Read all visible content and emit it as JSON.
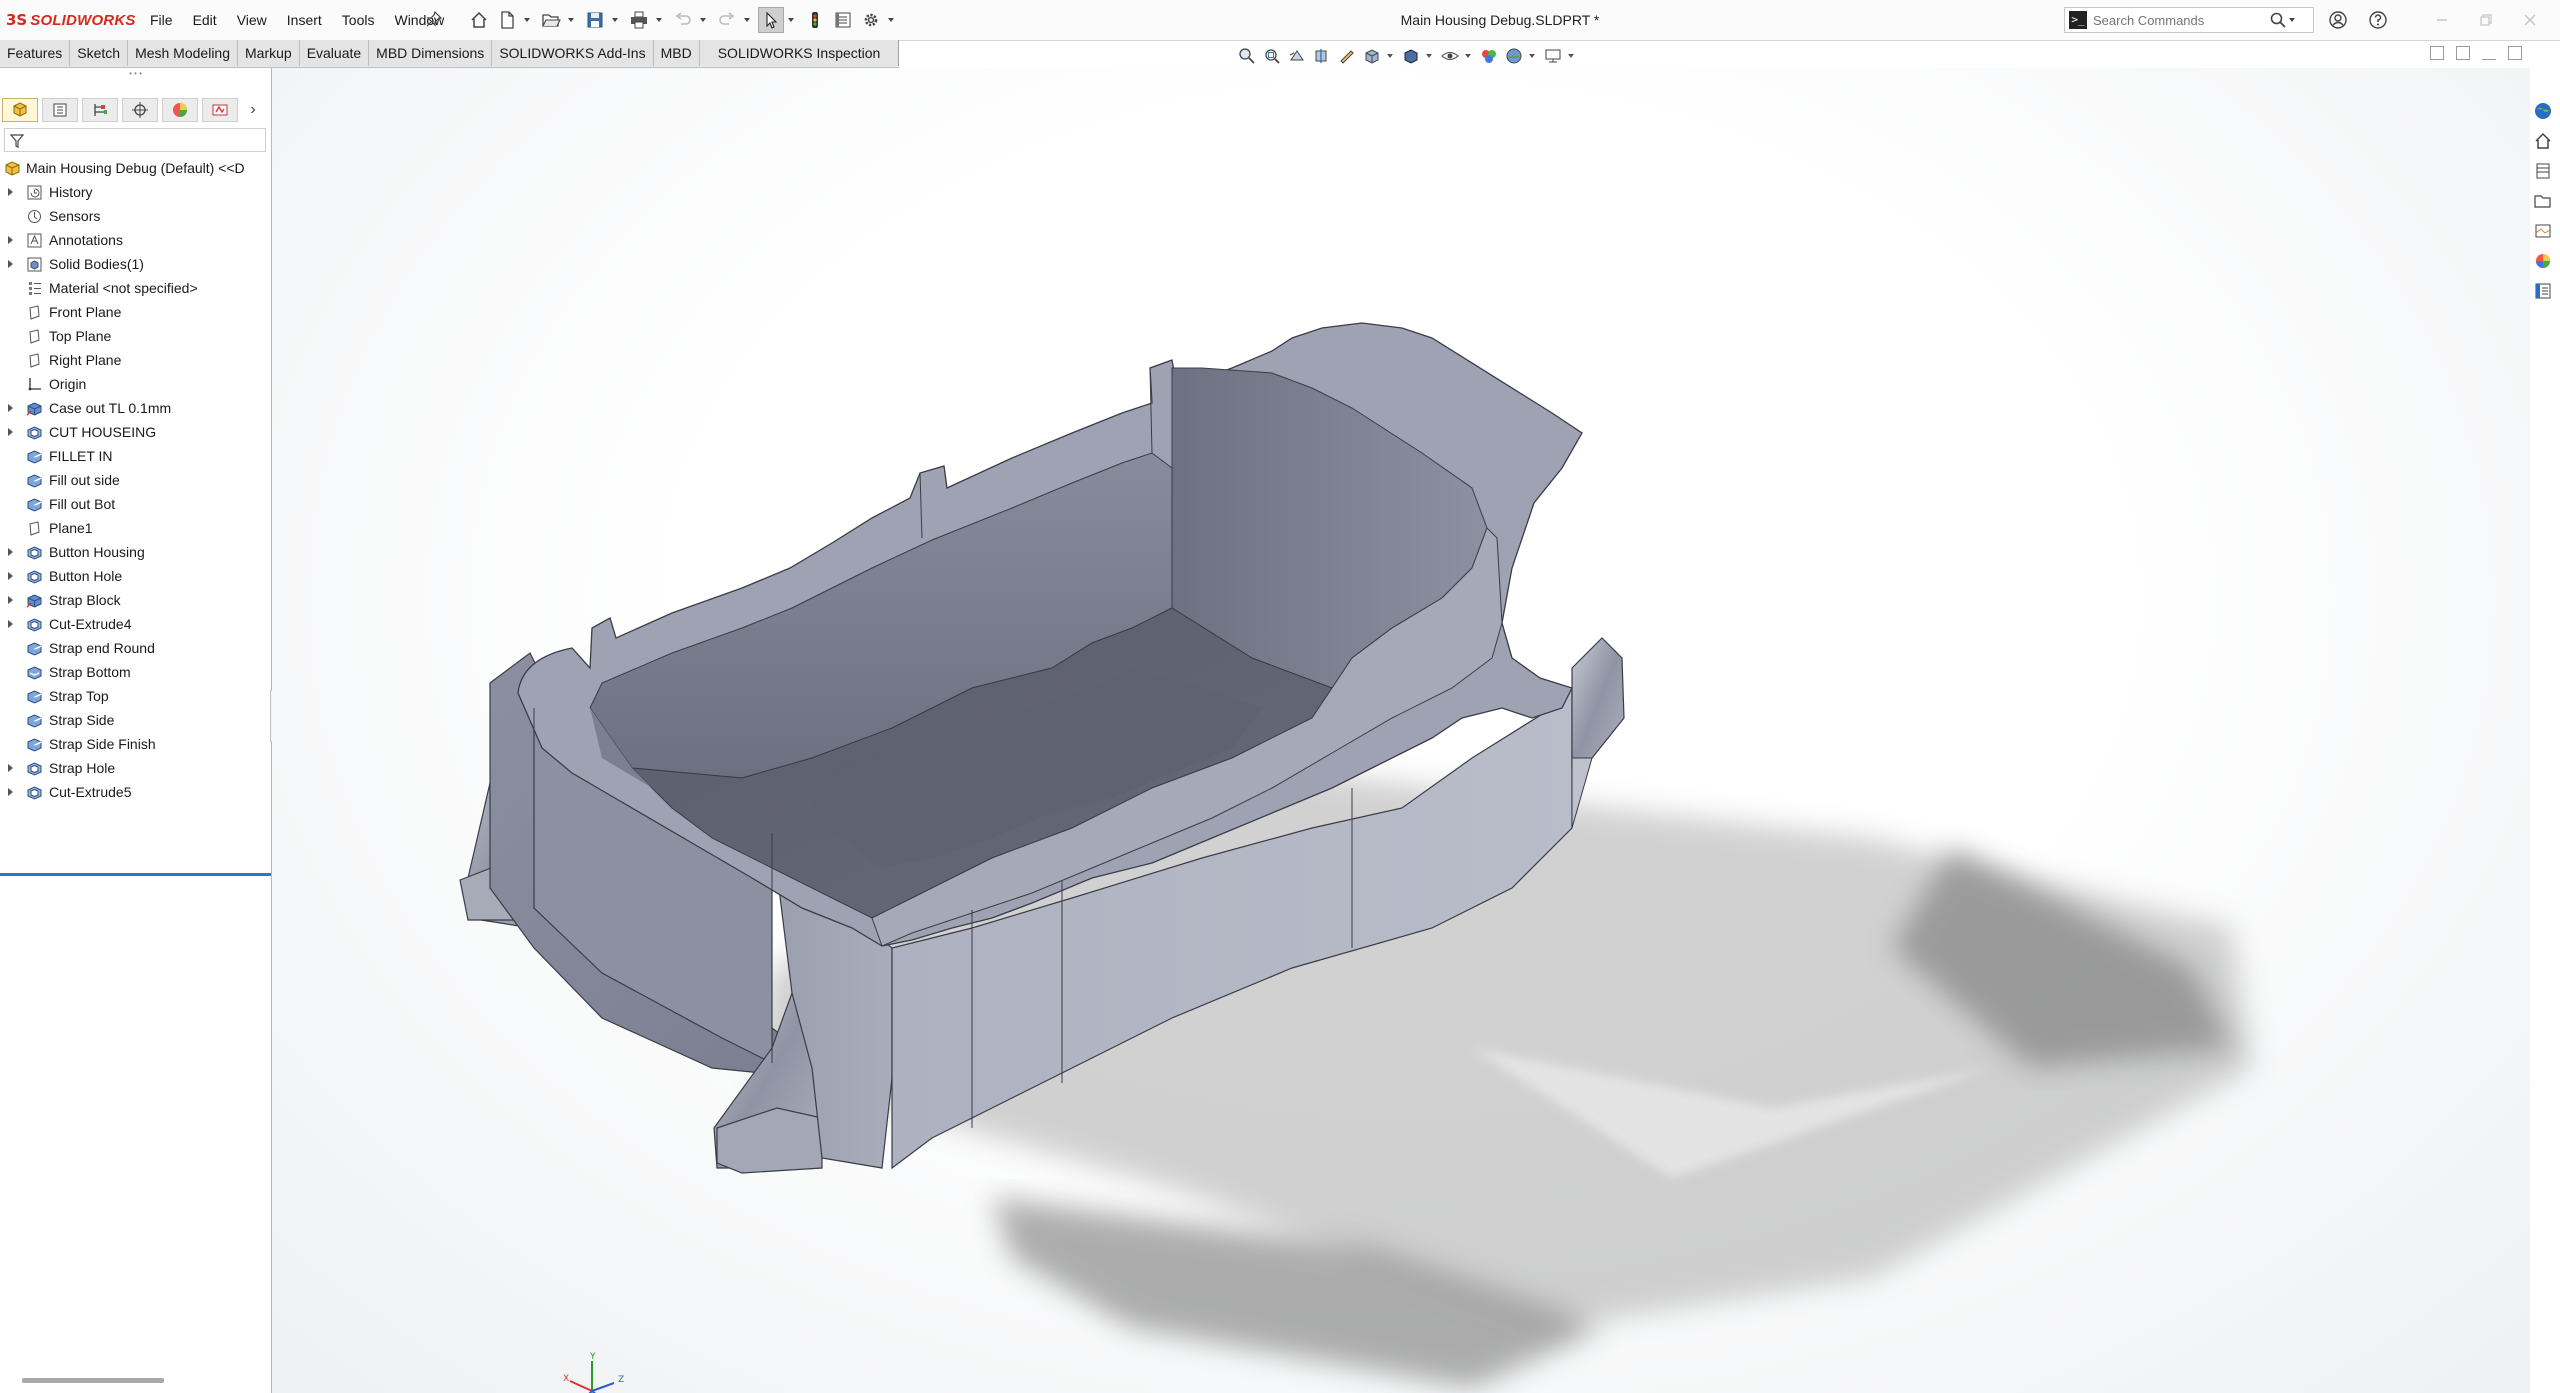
{
  "app": {
    "brand_prefix": "3S",
    "brand_name": "SOLIDWORKS",
    "document_title": "Main Housing  Debug.SLDPRT *"
  },
  "menu": [
    "File",
    "Edit",
    "View",
    "Insert",
    "Tools",
    "Window"
  ],
  "search": {
    "placeholder": "Search Commands",
    "prompt_glyph": ">_"
  },
  "tabs": [
    "Features",
    "Sketch",
    "Mesh Modeling",
    "Markup",
    "Evaluate",
    "MBD Dimensions",
    "SOLIDWORKS Add-Ins",
    "MBD",
    "SOLIDWORKS Inspection"
  ],
  "feature_tree": {
    "root": "Main Housing  Debug (Default) <<D",
    "items": [
      {
        "label": "History",
        "expandable": true,
        "icon": "history-icon"
      },
      {
        "label": "Sensors",
        "expandable": false,
        "icon": "sensor-icon"
      },
      {
        "label": "Annotations",
        "expandable": true,
        "icon": "annotation-icon"
      },
      {
        "label": "Solid Bodies(1)",
        "expandable": true,
        "icon": "solid-bodies-icon"
      },
      {
        "label": "Material <not specified>",
        "expandable": false,
        "icon": "material-icon"
      },
      {
        "label": "Front Plane",
        "expandable": false,
        "icon": "plane-icon"
      },
      {
        "label": "Top Plane",
        "expandable": false,
        "icon": "plane-icon"
      },
      {
        "label": "Right Plane",
        "expandable": false,
        "icon": "plane-icon"
      },
      {
        "label": "Origin",
        "expandable": false,
        "icon": "origin-icon"
      },
      {
        "label": "Case out TL 0.1mm",
        "expandable": true,
        "icon": "extrude-icon"
      },
      {
        "label": "CUT HOUSEING",
        "expandable": true,
        "icon": "cut-icon"
      },
      {
        "label": "FILLET IN",
        "expandable": false,
        "icon": "fillet-icon"
      },
      {
        "label": "Fill out side",
        "expandable": false,
        "icon": "fillet-icon"
      },
      {
        "label": "Fill out Bot",
        "expandable": false,
        "icon": "fillet-icon"
      },
      {
        "label": "Plane1",
        "expandable": false,
        "icon": "plane-icon"
      },
      {
        "label": "Button Housing",
        "expandable": true,
        "icon": "cut-icon"
      },
      {
        "label": "Button Hole",
        "expandable": true,
        "icon": "cut-icon"
      },
      {
        "label": "Strap Block",
        "expandable": true,
        "icon": "extrude-icon"
      },
      {
        "label": "Cut-Extrude4",
        "expandable": true,
        "icon": "cut-icon"
      },
      {
        "label": "Strap end Round",
        "expandable": false,
        "icon": "fillet-icon"
      },
      {
        "label": "Strap Bottom",
        "expandable": false,
        "icon": "chamfer-icon"
      },
      {
        "label": "Strap Top",
        "expandable": false,
        "icon": "fillet-icon"
      },
      {
        "label": "Strap Side",
        "expandable": false,
        "icon": "fillet-icon"
      },
      {
        "label": "Strap Side Finish",
        "expandable": false,
        "icon": "fillet-icon"
      },
      {
        "label": "Strap Hole",
        "expandable": true,
        "icon": "cut-icon"
      },
      {
        "label": "Cut-Extrude5",
        "expandable": true,
        "icon": "cut-icon"
      }
    ]
  },
  "triad": {
    "x": "X",
    "y": "Y",
    "z": "Z"
  },
  "colors": {
    "brand_red": "#da291c",
    "rollback_bar": "#2a78c8",
    "model_top": "#a4a8b6",
    "model_side": "#8e92a2",
    "model_floor": "#5b5e6c",
    "shadow": "#7d7d7d"
  }
}
